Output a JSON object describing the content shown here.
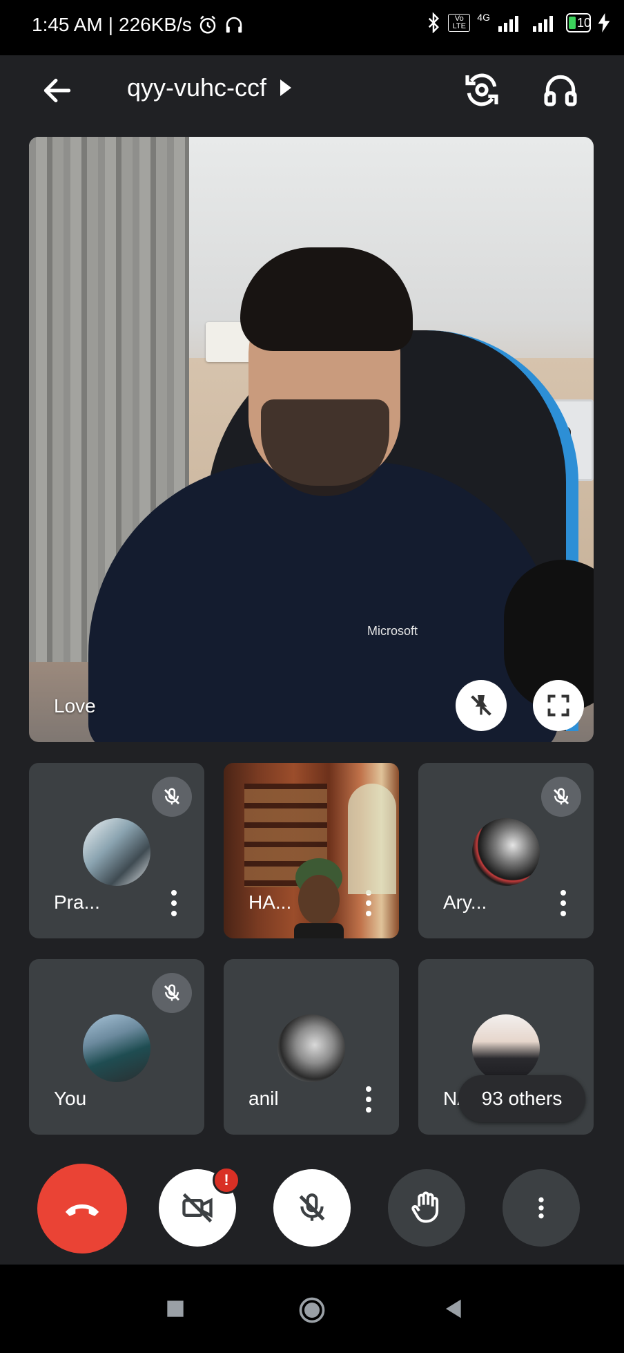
{
  "status_bar": {
    "time": "1:45 AM",
    "separator": "|",
    "net_speed": "226KB/s",
    "volte": "Vo LTE",
    "network": "4G",
    "battery": "10"
  },
  "header": {
    "meeting_code": "qyy-vuhc-ccf",
    "icons": [
      "back-arrow-icon",
      "chevron-right-icon",
      "flip-camera-icon",
      "headphones-icon"
    ]
  },
  "main_video": {
    "participant_name": "Love",
    "shirt_logo": "Microsoft"
  },
  "tiles": [
    {
      "name": "Pra...",
      "muted": true,
      "type": "avatar"
    },
    {
      "name": "HA...",
      "muted": false,
      "type": "video"
    },
    {
      "name": "Ary...",
      "muted": true,
      "type": "avatar"
    },
    {
      "name": "You",
      "muted": true,
      "type": "avatar"
    },
    {
      "name": "anil",
      "muted": false,
      "type": "avatar"
    },
    {
      "name": "NAGESHW",
      "muted": false,
      "type": "avatar"
    }
  ],
  "others_chip": "93 others",
  "controls": {
    "camera_alert": "!",
    "icons": [
      "end-call-icon",
      "camera-off-icon",
      "mic-off-icon",
      "raise-hand-icon",
      "more-options-icon"
    ]
  },
  "colors": {
    "background": "#202124",
    "tile": "#3c4043",
    "end_call": "#ea4335",
    "alert": "#d93025"
  }
}
